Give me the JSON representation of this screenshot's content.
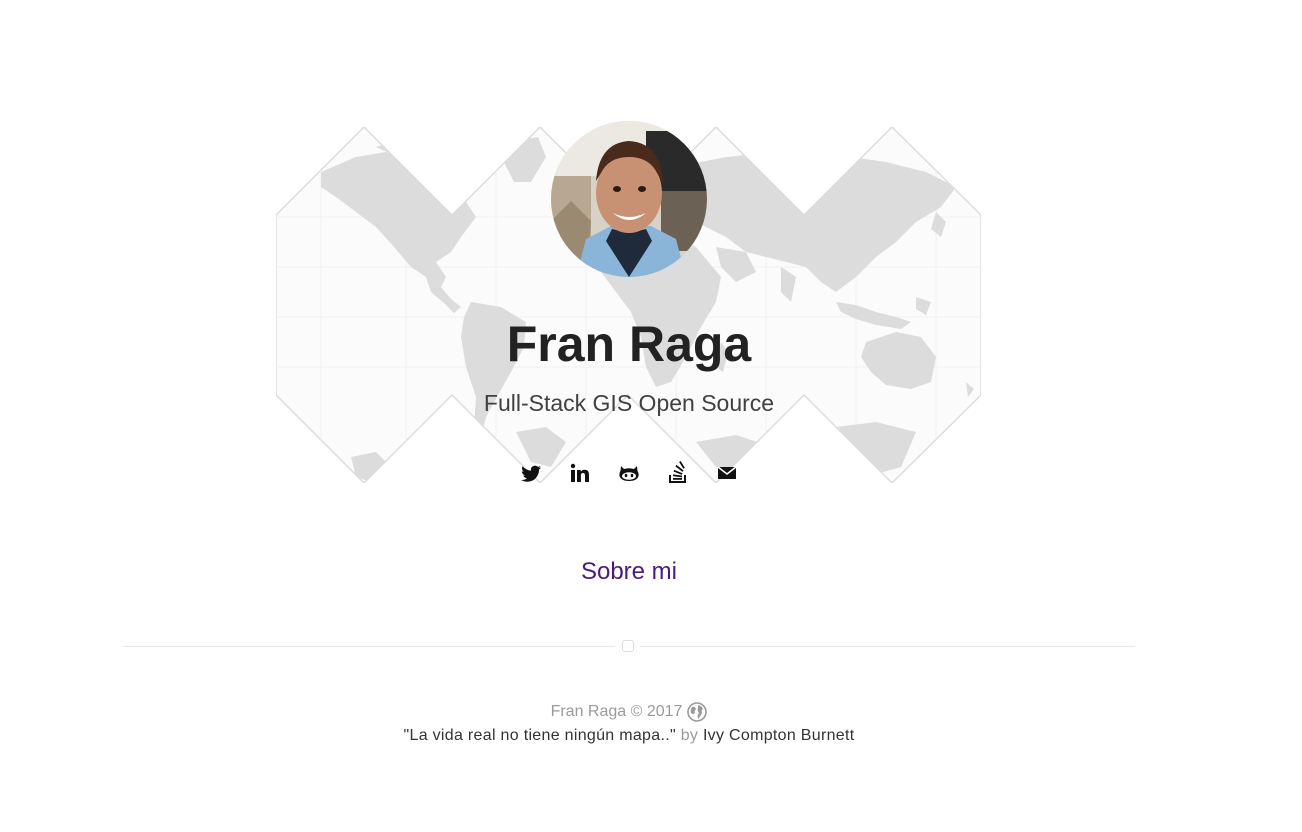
{
  "profile": {
    "name": "Fran Raga",
    "tagline": "Full-Stack GIS Open Source"
  },
  "social": [
    {
      "icon": "twitter-icon",
      "label": "Twitter"
    },
    {
      "icon": "linkedin-icon",
      "label": "LinkedIn"
    },
    {
      "icon": "github-icon",
      "label": "GitHub"
    },
    {
      "icon": "stackoverflow-icon",
      "label": "Stack Overflow"
    },
    {
      "icon": "mail-icon",
      "label": "Email"
    }
  ],
  "nav": {
    "about_label": "Sobre mi"
  },
  "footer": {
    "copyright": "Fran Raga © 2017",
    "quote": "\"La vida real no tiene ningún mapa..\"",
    "by": "by",
    "author": "Ivy Compton Burnett"
  },
  "colors": {
    "link": "#4a1a7f",
    "map_land": "#dcdcdc",
    "text_dark": "#222222"
  }
}
